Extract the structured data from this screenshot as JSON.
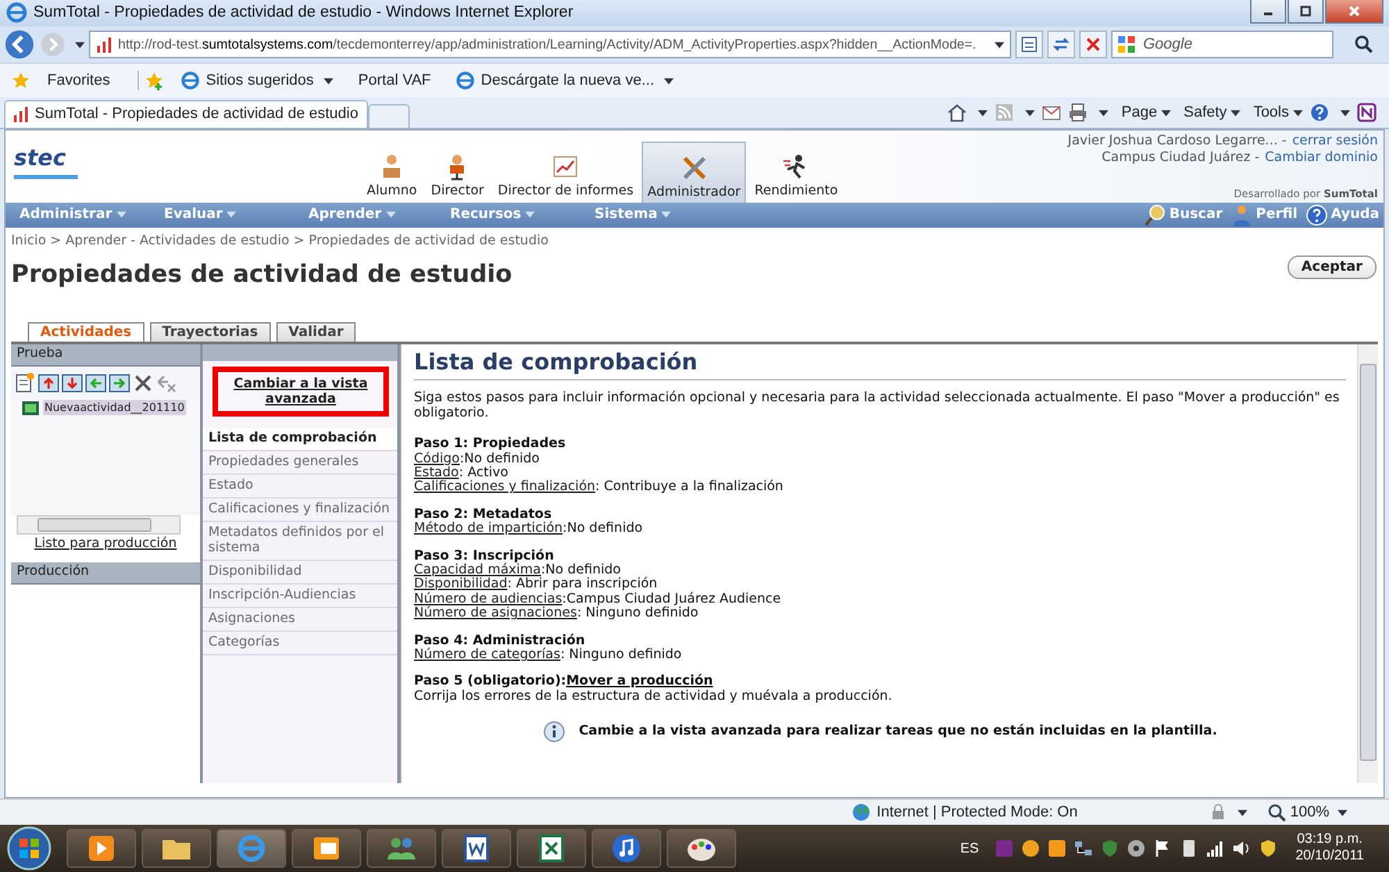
{
  "window": {
    "title": "SumTotal - Propiedades de actividad de estudio - Windows Internet Explorer"
  },
  "address_bar": {
    "url": "http://rod-test.**sumtotalsystems.com**/tecdemonterrey/app/administration/Learning/Activity/ADM_ActivityProperties.aspx?hidden__ActionMode=."
  },
  "search_box": {
    "placeholder": "Google"
  },
  "favorites_bar": [
    {
      "label": "Favorites",
      "kind": "star"
    },
    {
      "label": "Sitios sugeridos",
      "kind": "menu"
    },
    {
      "label": "Portal VAF",
      "kind": "plain"
    },
    {
      "label": "Descárgate la nueva ve...",
      "kind": "menu"
    }
  ],
  "browser_tab": {
    "title": "SumTotal - Propiedades de actividad de estudio"
  },
  "command_bar": [
    "Page",
    "Safety",
    "Tools"
  ],
  "header": {
    "logo": "stec",
    "user": "Javier Joshua Cardoso Legarre... -",
    "logout": "cerrar sesión",
    "campus": "Campus Ciudad Juárez -",
    "change_domain": "Cambiar dominio",
    "developed_by": "Desarrollado por **SumTotal**"
  },
  "role_tabs": [
    {
      "label": "Alumno",
      "selected": false
    },
    {
      "label": "Director",
      "selected": false
    },
    {
      "label": "Director de informes",
      "selected": false
    },
    {
      "label": "Administrador",
      "selected": true
    },
    {
      "label": "Rendimiento",
      "selected": false
    }
  ],
  "menu": [
    "Administrar",
    "Evaluar",
    "Aprender",
    "Recursos",
    "Sistema"
  ],
  "menu_right": [
    "Buscar",
    "Perfil",
    "Ayuda"
  ],
  "breadcrumb": "Inicio > Aprender - Actividades de estudio > Propiedades de actividad de estudio",
  "page_title": "Propiedades de actividad de estudio",
  "accept_button": "Aceptar",
  "tabs": [
    {
      "label": "Actividades",
      "selected": true
    },
    {
      "label": "Trayectorias",
      "selected": false
    },
    {
      "label": "Validar",
      "selected": false
    }
  ],
  "tree": {
    "title": "Prueba",
    "items": [
      {
        "label": "Nuevaactividad__201110",
        "selected": true
      }
    ],
    "link": "Listo para producción",
    "production_title": "Producción"
  },
  "switch_view_link": "Cambiar a la vista avanzada",
  "nav": [
    {
      "label": "Lista de comprobación",
      "selected": true
    },
    {
      "label": "Propiedades generales",
      "selected": false
    },
    {
      "label": "Estado",
      "selected": false
    },
    {
      "label": "Calificaciones y finalización",
      "selected": false
    },
    {
      "label": "Metadatos definidos por el sistema",
      "selected": false
    },
    {
      "label": "Disponibilidad",
      "selected": false
    },
    {
      "label": "Inscripción-Audiencias",
      "selected": false
    },
    {
      "label": "Asignaciones",
      "selected": false
    },
    {
      "label": "Categorías",
      "selected": false
    }
  ],
  "content": {
    "title": "Lista de comprobación",
    "intro": "Siga estos pasos para incluir información opcional y necesaria para la actividad seleccionada actualmente. El paso \"Mover a producción\" es obligatorio.",
    "steps": [
      {
        "heading": "Paso 1: Propiedades",
        "details": [
          {
            "label": "Código",
            "value": ":No definido"
          },
          {
            "label": "Estado",
            "value": ": Activo"
          },
          {
            "label": "Calificaciones y finalización",
            "value": ": Contribuye a la finalización"
          }
        ]
      },
      {
        "heading": "Paso 2: Metadatos",
        "details": [
          {
            "label": "Método de impartición",
            "value": ":No definido"
          }
        ]
      },
      {
        "heading": "Paso 3: Inscripción",
        "details": [
          {
            "label": "Capacidad máxima",
            "value": ":No definido"
          },
          {
            "label": "Disponibilidad",
            "value": ": Abrir para inscripción"
          },
          {
            "label": "Número de audiencias",
            "value": ":Campus Ciudad Juárez Audience"
          },
          {
            "label": "Número de asignaciones",
            "value": ": Ninguno definido"
          }
        ]
      },
      {
        "heading": "Paso 4: Administración",
        "details": [
          {
            "label": "Número de categorías",
            "value": ": Ninguno definido"
          }
        ]
      },
      {
        "heading": "Paso 5 (obligatorio):",
        "heading_link": "Mover a producción",
        "text": "Corrija los errores de la estructura de actividad y muévala a producción."
      }
    ],
    "note": "Cambie a la vista avanzada para realizar tareas que no están incluidas en la plantilla."
  },
  "status_bar": {
    "zone": "Internet | Protected Mode: On",
    "zoom": "100%"
  },
  "taskbar": {
    "language": "ES",
    "time": "03:19 p.m.",
    "date": "20/10/2011"
  }
}
